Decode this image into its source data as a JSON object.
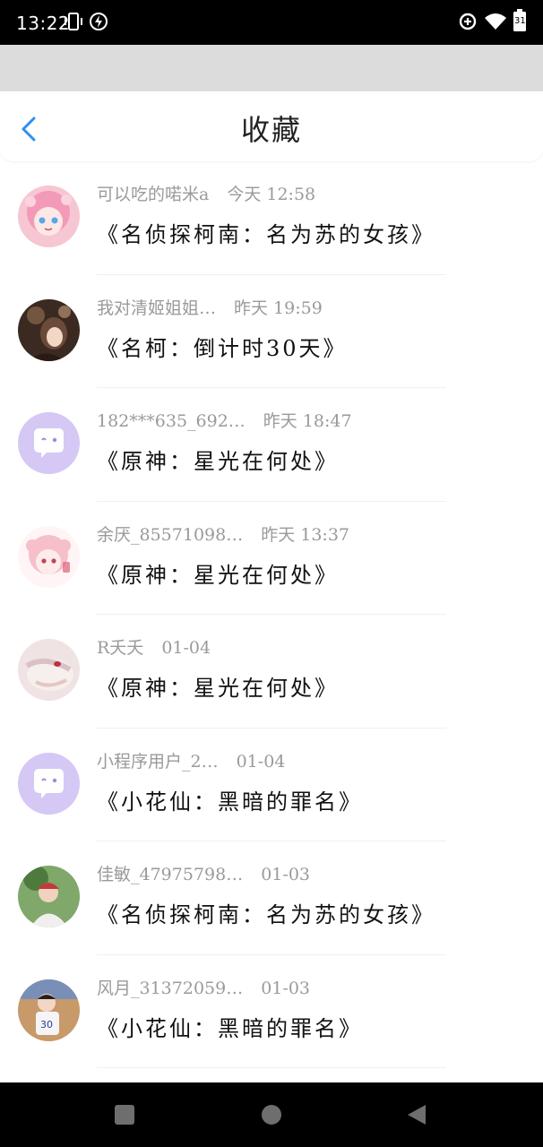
{
  "status_bar": {
    "time": "13:22",
    "battery": "31",
    "icons": [
      "vibrate-icon",
      "charging-icon",
      "data-saver-icon",
      "wifi-icon",
      "battery-icon"
    ]
  },
  "header": {
    "title": "收藏",
    "back_icon": "chevron-left-icon",
    "accent_color": "#2f8ff0"
  },
  "favorites": [
    {
      "user": "可以吃的喏米a",
      "time": "今天 12:58",
      "title": "《名侦探柯南：名为苏的女孩》",
      "avatar": "anime-pink-hair-girl"
    },
    {
      "user": "我对清姬姐姐…",
      "time": "昨天 19:59",
      "title": "《名柯：倒计时30天》",
      "avatar": "dark-portrait"
    },
    {
      "user": "182***635_692…",
      "time": "昨天 18:47",
      "title": "《原神：星光在何处》",
      "avatar": "default-chat-bubble"
    },
    {
      "user": "余厌_85571098…",
      "time": "昨天 13:37",
      "title": "《原神：星光在何处》",
      "avatar": "anime-pink-girl"
    },
    {
      "user": "R夭夭",
      "time": "01-04",
      "title": "《原神：星光在何处》",
      "avatar": "anime-sleeping-girl"
    },
    {
      "user": "小程序用户_2…",
      "time": "01-04",
      "title": "《小花仙：黑暗的罪名》",
      "avatar": "default-chat-bubble"
    },
    {
      "user": "佳敏_47975798…",
      "time": "01-03",
      "title": "《名侦探柯南：名为苏的女孩》",
      "avatar": "child-photo"
    },
    {
      "user": "风月_31372059…",
      "time": "01-03",
      "title": "《小花仙：黑暗的罪名》",
      "avatar": "kid-jersey-photo"
    }
  ],
  "nav_bar": {
    "buttons": [
      "recents-square-icon",
      "home-circle-icon",
      "back-triangle-icon"
    ]
  }
}
